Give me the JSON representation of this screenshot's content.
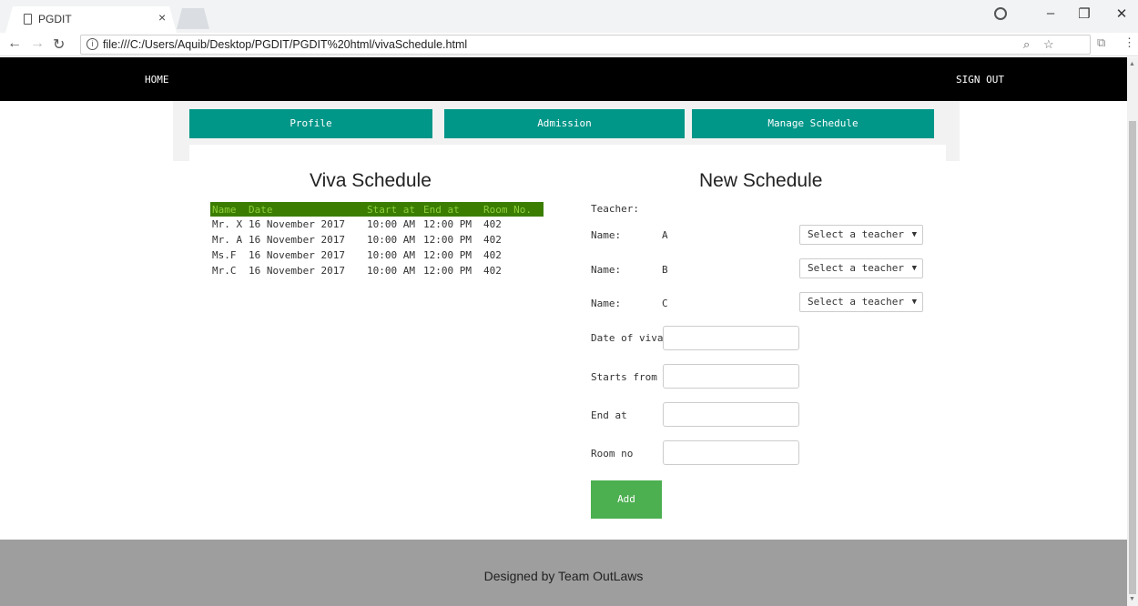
{
  "browser": {
    "tab_title": "PGDIT",
    "tab_close": "×",
    "url": "file:///C:/Users/Aquib/Desktop/PGDIT/PGDIT%20html/vivaSchedule.html",
    "icons": [
      "page-icon",
      "back-icon",
      "forward-icon",
      "reload-icon",
      "info-icon",
      "zoom-icon",
      "star-icon",
      "extension-icon",
      "profile-icon",
      "minimize-icon",
      "restore-icon",
      "close-icon",
      "menu-icon"
    ]
  },
  "topnav": {
    "home": "HOME",
    "signout": "SIGN OUT"
  },
  "menu": {
    "profile": "Profile",
    "admission": "Admission",
    "manage": "Manage Schedule"
  },
  "viva": {
    "title": "Viva Schedule",
    "headers": [
      "Name",
      "Date",
      "Start at",
      "End at",
      "Room No."
    ],
    "rows": [
      [
        "Mr. X",
        "16 November 2017",
        "10:00 AM",
        "12:00 PM",
        "402"
      ],
      [
        "Mr. A",
        "16 November 2017",
        "10:00 AM",
        "12:00 PM",
        "402"
      ],
      [
        "Ms.F",
        "16 November 2017",
        "10:00 AM",
        "12:00 PM",
        "402"
      ],
      [
        "Mr.C",
        "16 November 2017",
        "10:00 AM",
        "12:00 PM",
        "402"
      ]
    ]
  },
  "form": {
    "title": "New Schedule",
    "teacher_label": "Teacher:",
    "name_label": "Name:",
    "teachers": [
      {
        "letter": "A",
        "select": "Select a teacher"
      },
      {
        "letter": "B",
        "select": "Select a teacher"
      },
      {
        "letter": "C",
        "select": "Select a teacher"
      }
    ],
    "select_arrow": "▼",
    "date_label": "Date of viva",
    "start_label": "Starts from",
    "end_label": "End at",
    "room_label": "Room no",
    "add_label": "Add"
  },
  "footer": {
    "text": "Designed by Team OutLaws"
  },
  "colors": {
    "nav": "#000000",
    "menu_button": "#009688",
    "table_header": "#3a7d00",
    "add_button": "#4caf50",
    "footer": "#9e9e9e"
  }
}
